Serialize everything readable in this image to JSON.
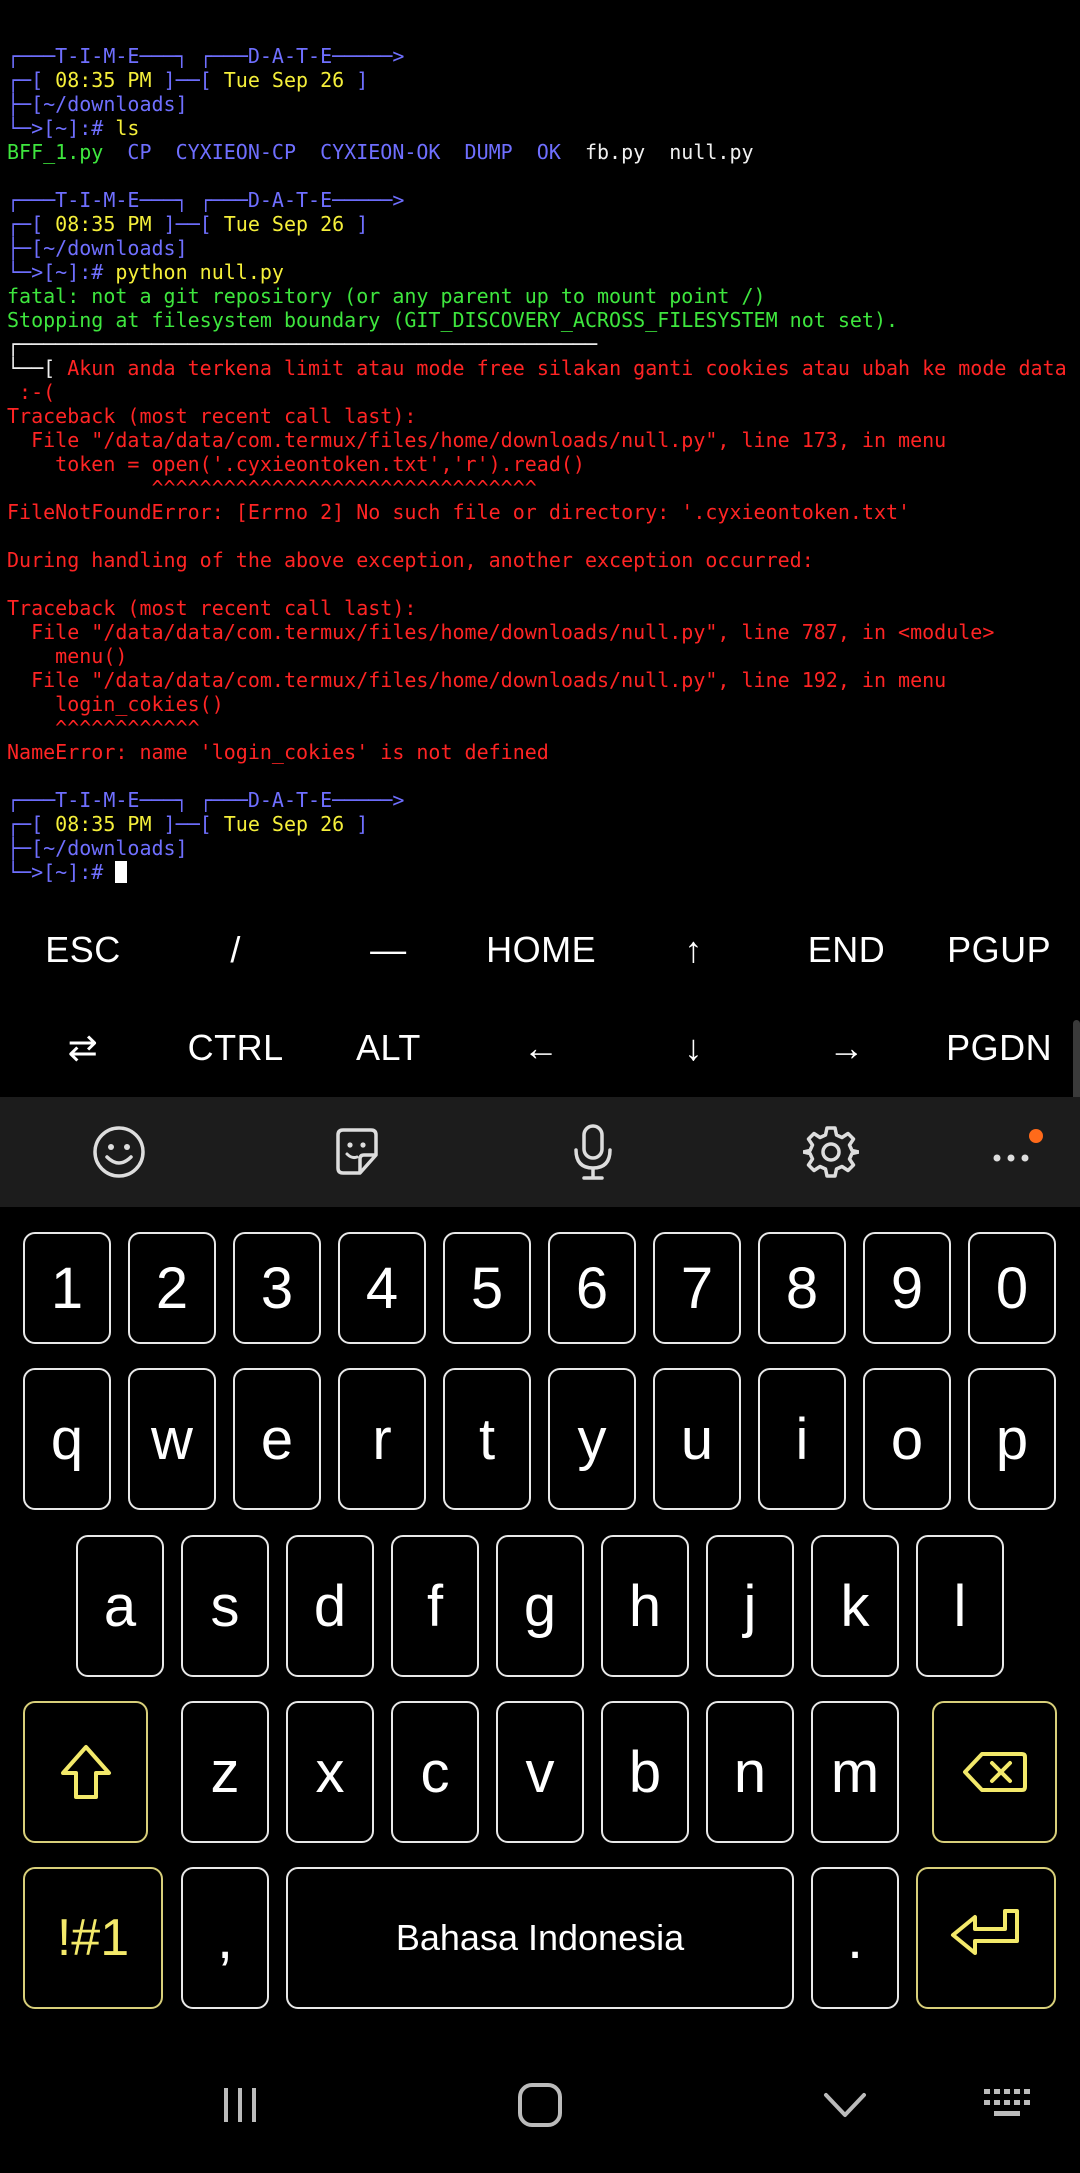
{
  "terminal": {
    "lines": [
      [
        {
          "t": "┌───T-I-M-E───┐ ┌───D-A-T-E─────>",
          "c": "blue"
        }
      ],
      [
        {
          "t": "┌─[ ",
          "c": "blue"
        },
        {
          "t": "08:35 PM",
          "c": "yellow"
        },
        {
          "t": " ]──[ ",
          "c": "blue"
        },
        {
          "t": "Tue Sep 26",
          "c": "yellow"
        },
        {
          "t": " ]",
          "c": "blue"
        }
      ],
      [
        {
          "t": "├─[~/downloads]",
          "c": "blue"
        }
      ],
      [
        {
          "t": "└─>[~]:# ",
          "c": "blue"
        },
        {
          "t": "ls",
          "c": "yellow"
        }
      ],
      [
        {
          "t": "BFF_1.py",
          "c": "green"
        },
        {
          "t": "  CP  CYXIEON-CP  CYXIEON-OK  DUMP  OK  ",
          "c": "blue"
        },
        {
          "t": "fb.py  null.py",
          "c": "white"
        }
      ],
      [],
      [
        {
          "t": "┌───T-I-M-E───┐ ┌───D-A-T-E─────>",
          "c": "blue"
        }
      ],
      [
        {
          "t": "┌─[ ",
          "c": "blue"
        },
        {
          "t": "08:35 PM",
          "c": "yellow"
        },
        {
          "t": " ]──[ ",
          "c": "blue"
        },
        {
          "t": "Tue Sep 26",
          "c": "yellow"
        },
        {
          "t": " ]",
          "c": "blue"
        }
      ],
      [
        {
          "t": "├─[~/downloads]",
          "c": "blue"
        }
      ],
      [
        {
          "t": "└─>[~]:# ",
          "c": "blue"
        },
        {
          "t": "python null.py",
          "c": "yellow"
        }
      ],
      [
        {
          "t": "fatal: not a git repository (or any parent up to mount point /)",
          "c": "green"
        }
      ],
      [
        {
          "t": "Stopping at filesystem boundary (GIT_DISCOVERY_ACROSS_FILESYSTEM not set).",
          "c": "green"
        }
      ],
      [
        {
          "t": "┌────────────────────────────────────────────────",
          "c": "white"
        }
      ],
      [
        {
          "t": "└──[ ",
          "c": "white"
        },
        {
          "t": "Akun anda terkena limit atau mode free silakan ganti cookies atau ubah ke mode data",
          "c": "red"
        }
      ],
      [
        {
          "t": " :-(",
          "c": "red"
        }
      ],
      [
        {
          "t": "Traceback (most recent call last):",
          "c": "red"
        }
      ],
      [
        {
          "t": "  File \"/data/data/com.termux/files/home/downloads/null.py\", line 173, in menu",
          "c": "red"
        }
      ],
      [
        {
          "t": "    token = open('.cyxieontoken.txt','r').read()",
          "c": "red"
        }
      ],
      [
        {
          "t": "            ^^^^^^^^^^^^^^^^^^^^^^^^^^^^^^^^",
          "c": "red"
        }
      ],
      [
        {
          "t": "FileNotFoundError: [Errno 2] No such file or directory: '.cyxieontoken.txt'",
          "c": "red"
        }
      ],
      [],
      [
        {
          "t": "During handling of the above exception, another exception occurred:",
          "c": "red"
        }
      ],
      [],
      [
        {
          "t": "Traceback (most recent call last):",
          "c": "red"
        }
      ],
      [
        {
          "t": "  File \"/data/data/com.termux/files/home/downloads/null.py\", line 787, in <module>",
          "c": "red"
        }
      ],
      [
        {
          "t": "    menu()",
          "c": "red"
        }
      ],
      [
        {
          "t": "  File \"/data/data/com.termux/files/home/downloads/null.py\", line 192, in menu",
          "c": "red"
        }
      ],
      [
        {
          "t": "    login_cokies()",
          "c": "red"
        }
      ],
      [
        {
          "t": "    ^^^^^^^^^^^^",
          "c": "red"
        }
      ],
      [
        {
          "t": "NameError: name 'login_cokies' is not defined",
          "c": "red"
        }
      ],
      [],
      [
        {
          "t": "┌───T-I-M-E───┐ ┌───D-A-T-E─────>",
          "c": "blue"
        }
      ],
      [
        {
          "t": "┌─[ ",
          "c": "blue"
        },
        {
          "t": "08:35 PM",
          "c": "yellow"
        },
        {
          "t": " ]──[ ",
          "c": "blue"
        },
        {
          "t": "Tue Sep 26",
          "c": "yellow"
        },
        {
          "t": " ]",
          "c": "blue"
        }
      ],
      [
        {
          "t": "├─[~/downloads]",
          "c": "blue"
        }
      ],
      [
        {
          "t": "└─>[~]:# ",
          "c": "blue"
        }
      ]
    ]
  },
  "extra_keys": {
    "row1": [
      "ESC",
      "/",
      "—",
      "HOME",
      "↑",
      "END",
      "PGUP"
    ],
    "row2": [
      "⇄",
      "CTRL",
      "ALT",
      "←",
      "↓",
      "→",
      "PGDN"
    ]
  },
  "toolbar": {
    "icons": [
      "emoji-icon",
      "sticker-icon",
      "microphone-icon",
      "settings-icon",
      "more-icon"
    ]
  },
  "keyboard": {
    "numbers": [
      "1",
      "2",
      "3",
      "4",
      "5",
      "6",
      "7",
      "8",
      "9",
      "0"
    ],
    "row_q": [
      "q",
      "w",
      "e",
      "r",
      "t",
      "y",
      "u",
      "i",
      "o",
      "p"
    ],
    "row_a": [
      "a",
      "s",
      "d",
      "f",
      "g",
      "h",
      "j",
      "k",
      "l"
    ],
    "row_z": [
      "z",
      "x",
      "c",
      "v",
      "b",
      "n",
      "m"
    ],
    "symbols_label": "!#1",
    "comma": ",",
    "space_label": "Bahasa Indonesia",
    "period": "."
  },
  "colors": {
    "blue": "#6f6fff",
    "yellow": "#f5ef3a",
    "green": "#3ee63e",
    "red": "#ff2424",
    "accent_key": "#f3e96a",
    "notification_dot": "#ff6a1a"
  }
}
